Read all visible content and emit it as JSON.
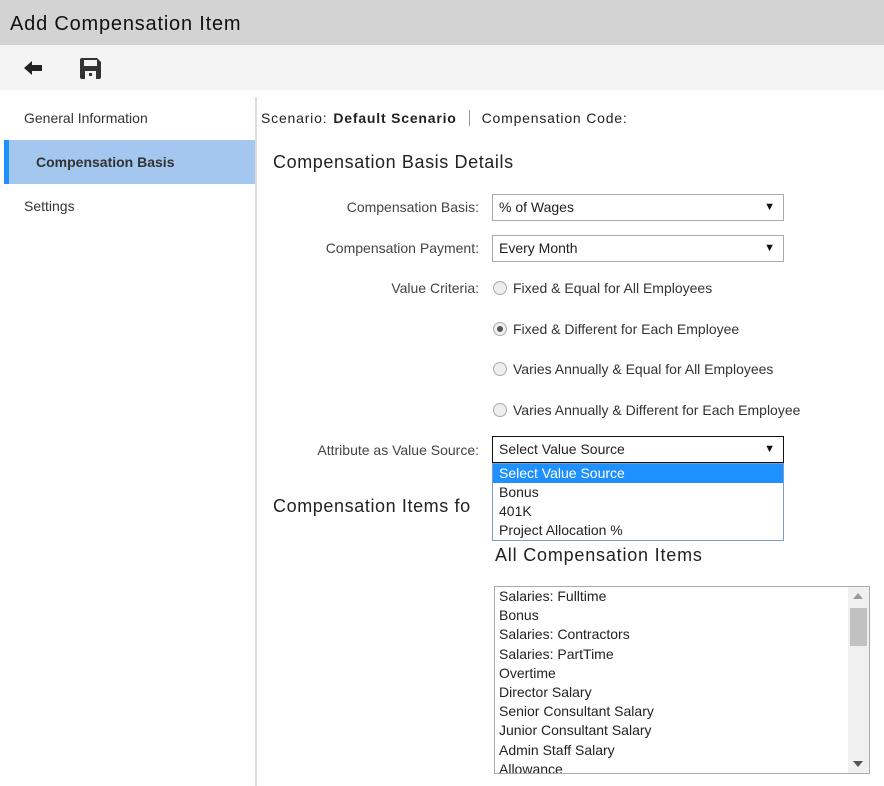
{
  "window": {
    "title": "Add Compensation Item"
  },
  "toolbar": {
    "back_icon": "arrow-left-icon",
    "save_icon": "floppy-disk-icon"
  },
  "sidebar": {
    "items": [
      {
        "label": "General Information"
      },
      {
        "label": "Compensation Basis",
        "active": true
      },
      {
        "label": "Settings"
      }
    ]
  },
  "header": {
    "scenario_label": "Scenario:",
    "scenario_value": "Default Scenario",
    "code_label": "Compensation Code:"
  },
  "section": {
    "title": "Compensation Basis Details"
  },
  "form": {
    "basis_label": "Compensation Basis:",
    "basis_value": "% of Wages",
    "payment_label": "Compensation Payment:",
    "payment_value": "Every Month",
    "criteria_label": "Value Criteria:",
    "criteria_options": [
      {
        "label": "Fixed & Equal for All Employees",
        "checked": false
      },
      {
        "label": "Fixed & Different for Each Employee",
        "checked": true
      },
      {
        "label": "Varies Annually & Equal for All Employees",
        "checked": false
      },
      {
        "label": "Varies Annually & Different for Each Employee",
        "checked": false
      }
    ],
    "source_label": "Attribute as Value Source:",
    "source_value": "Select Value Source",
    "source_options": [
      "Select Value Source",
      "Bonus",
      "401K",
      "Project Allocation %"
    ]
  },
  "items_section": {
    "title": "Compensation Items fo",
    "all_title": "All Compensation Items",
    "items": [
      "Salaries: Fulltime",
      "Bonus",
      "Salaries: Contractors",
      "Salaries: PartTime",
      "Overtime",
      "Director Salary",
      "Senior Consultant Salary",
      "Junior Consultant Salary",
      "Admin Staff Salary",
      "Allowance"
    ]
  },
  "colors": {
    "active_bg": "#a3c7ef",
    "accent": "#1e90ff"
  }
}
